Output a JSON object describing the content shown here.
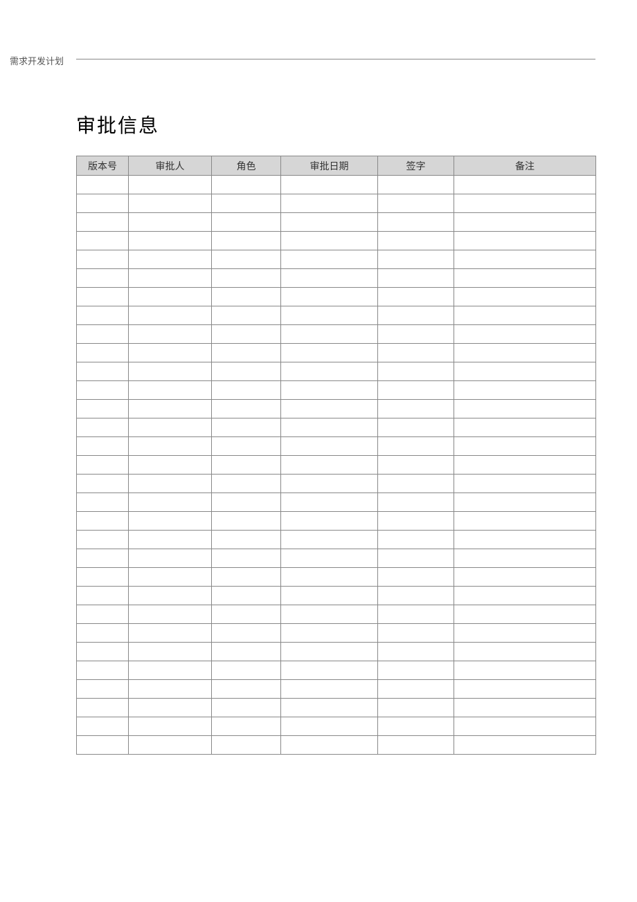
{
  "header": {
    "label": "需求开发计划"
  },
  "title": "审批信息",
  "table": {
    "columns": [
      "版本号",
      "审批人",
      "角色",
      "审批日期",
      "签字",
      "备注"
    ],
    "row_count": 31
  }
}
